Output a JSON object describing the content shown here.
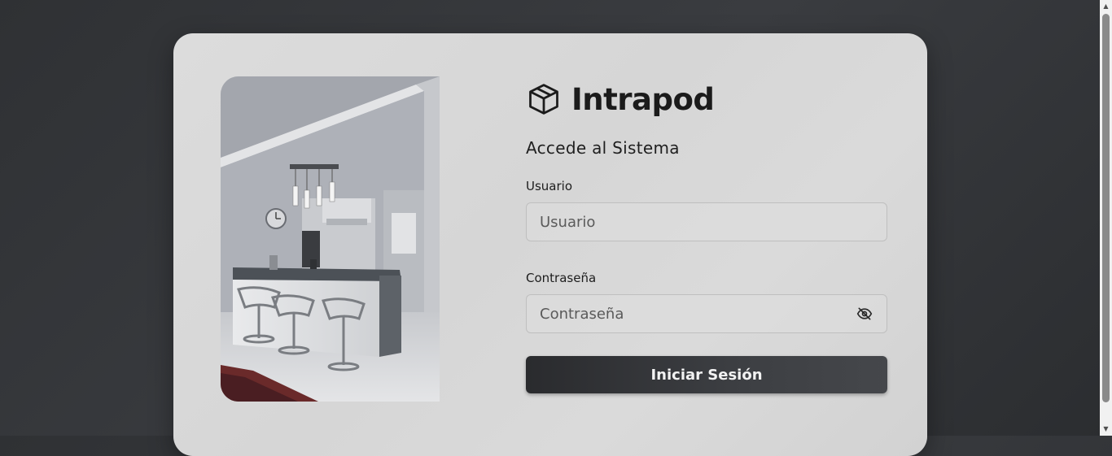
{
  "brand": {
    "name": "Intrapod",
    "icon": "package-box-icon"
  },
  "login": {
    "subtitle": "Accede al Sistema",
    "username_label": "Usuario",
    "username_placeholder": "Usuario",
    "username_value": "",
    "password_label": "Contraseña",
    "password_placeholder": "Contraseña",
    "password_value": "",
    "password_toggle_icon": "eye-off-icon",
    "submit_label": "Iniciar Sesión"
  },
  "image": {
    "subject": "kitchen-interior-photo"
  },
  "colors": {
    "card_background": "#d8d8d8",
    "page_background": "#333538",
    "button_background": "#2f3033",
    "button_text": "#f2f2f2",
    "text_primary": "#1b1b1b"
  },
  "scrollbar": {
    "up_icon": "▲",
    "down_icon": "▼"
  }
}
